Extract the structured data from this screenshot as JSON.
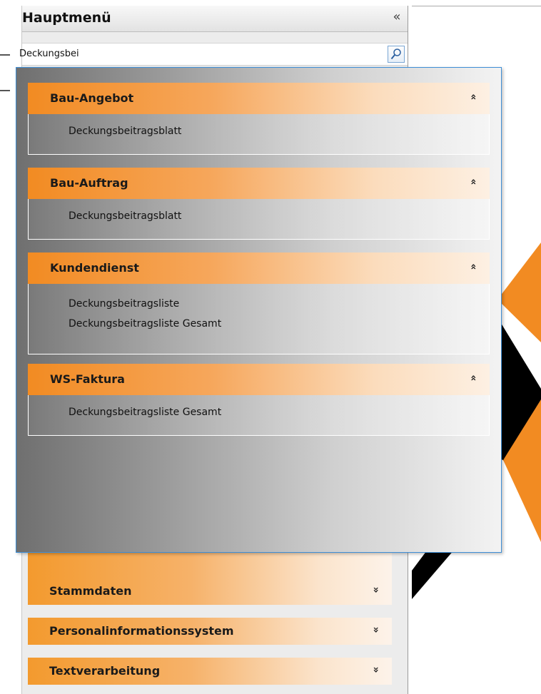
{
  "main_menu": {
    "title": "Hauptmenü",
    "collapse_icon": "double-chevron-left-icon",
    "collapse_glyph": "«",
    "search": {
      "value": "Deckungsbei",
      "button_icon": "search-icon"
    },
    "collapsed_items": [
      {
        "label": "Stammdaten",
        "chevron": "»"
      },
      {
        "label": "Personalinformationssystem",
        "chevron": "»"
      },
      {
        "label": "Textverarbeitung",
        "chevron": "»"
      }
    ]
  },
  "search_results": {
    "groups": [
      {
        "label": "Bau-Angebot",
        "chevron": "»",
        "items": [
          "Deckungsbeitragsblatt"
        ]
      },
      {
        "label": "Bau-Auftrag",
        "chevron": "»",
        "items": [
          "Deckungsbeitragsblatt"
        ]
      },
      {
        "label": "Kundendienst",
        "chevron": "»",
        "items": [
          "Deckungsbeitragsliste",
          "Deckungsbeitragsliste Gesamt"
        ]
      },
      {
        "label": "WS-Faktura",
        "chevron": "»",
        "items": [
          "Deckungsbeitragsliste Gesamt"
        ]
      }
    ]
  },
  "colors": {
    "accent_orange": "#f28b22",
    "popup_border": "#3e8ed6",
    "logo_black": "#000000"
  }
}
